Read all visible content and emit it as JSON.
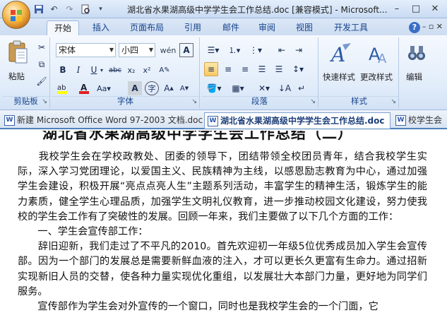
{
  "window": {
    "title": "湖北省水果湖高级中学学生会工作总结.doc [兼容模式] - Microsoft...",
    "controls": [
      "–",
      "□",
      "✕"
    ]
  },
  "ribbon_tabs": [
    "开始",
    "插入",
    "页面布局",
    "引用",
    "邮件",
    "审阅",
    "视图",
    "开发工具"
  ],
  "help_icon": "?",
  "clipboard": {
    "paste_label": "粘贴",
    "group_label": "剪贴板"
  },
  "font": {
    "name": "宋体",
    "size": "小四",
    "group_label": "字体"
  },
  "paragraph": {
    "group_label": "段落"
  },
  "styles": {
    "quick_label": "快速样式",
    "change_label": "更改样式",
    "group_label": "样式"
  },
  "editing": {
    "label": "编辑"
  },
  "doc_tabs": [
    "新建 Microsoft Office Word 97-2003 文档.doc",
    "湖北省水果湖高级中学学生会工作总结.doc",
    "校学生会"
  ],
  "document": {
    "title": "湖北省水果湖高级中学学生会工作总结（二）",
    "paragraphs": [
      "　　我校学生会在学校政教处、团委的领导下，团结带领全校团员青年，结合我校学生实际，深入学习党团理论，以爱国主义、民族精神为主线，以感恩励志教育为中心，通过加强学生会建设，积极开展“亮点点亮人生”主题系列活动，丰富学生的精神生活，锻炼学生的能力素质，健全学生心理品质，加强学生文明礼仪教育，进一步推动校园文化建设，努力使我校的学生会工作有了突破性的发展。回顾一年来，我们主要做了以下几个方面的工作：",
      "　　一、学生会宣传部工作：",
      "　　辞旧迎新，我们走过了不平凡的2010。首先欢迎初一年级5位优秀成员加入学生会宣传部。因为一个部门的发展总是需要新鲜血液的注入，才可以更长久更富有生命力。通过招新实现新旧人员的交替，使各种力量实现优化重组，以发展壮大本部门力量，更好地为同学们服务。",
      "　　宣传部作为学生会对外宣传的一个窗口，同时也是我校学生会的一个门面，它"
    ]
  }
}
